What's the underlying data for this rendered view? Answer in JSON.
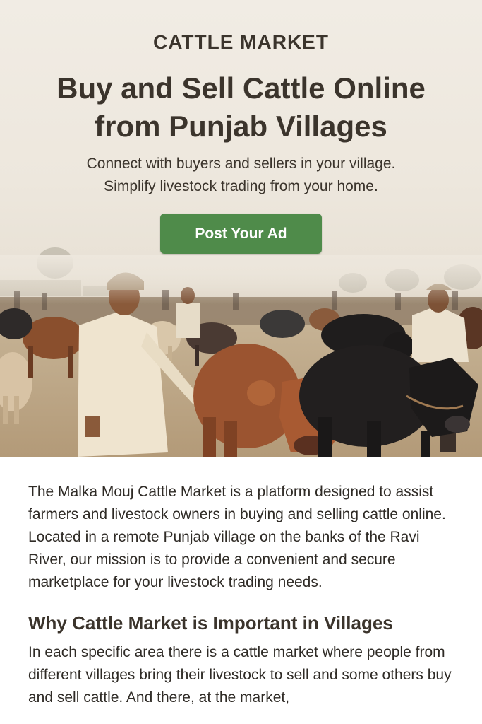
{
  "hero": {
    "eyebrow": "CATTLE MARKET",
    "headline_line1": "Buy and Sell Cattle Online",
    "headline_line2": "from Punjab Villages",
    "subline_line1": "Connect with buyers and sellers in your village.",
    "subline_line2": "Simplify livestock trading from your home.",
    "cta_label": "Post Your Ad",
    "photo_icon": "cattle-market-photo"
  },
  "content": {
    "intro": "The Malka Mouj Cattle Market is a platform designed to assist farmers and livestock owners in buying and selling cattle online. Located in a remote Punjab village on the banks of the Ravi River, our mission is to provide a convenient and secure marketplace for your livestock trading needs.",
    "section_title": "Why Cattle Market is Important in Villages",
    "section_body": "In each specific area there is a cattle market where people from different villages bring their livestock to sell and some others buy and sell cattle. And there, at the market,"
  },
  "colors": {
    "accent_green": "#4f8b4a",
    "hero_bg": "#efe9e0",
    "heading_text": "#3b342c"
  }
}
